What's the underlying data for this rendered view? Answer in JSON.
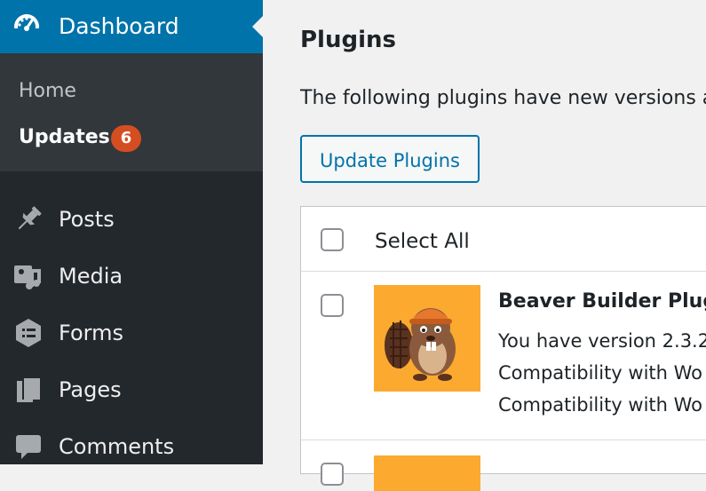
{
  "sidebar": {
    "dashboard": {
      "label": "Dashboard",
      "icon": "dashboard-gauge-icon"
    },
    "submenu": {
      "home": "Home",
      "updates": "Updates",
      "updates_count": "6"
    },
    "items": [
      {
        "label": "Posts",
        "icon": "pushpin-icon"
      },
      {
        "label": "Media",
        "icon": "media-icon"
      },
      {
        "label": "Forms",
        "icon": "forms-icon"
      },
      {
        "label": "Pages",
        "icon": "pages-icon"
      },
      {
        "label": "Comments",
        "icon": "comment-bubble-icon"
      }
    ]
  },
  "main": {
    "title": "Plugins",
    "intro": "The following plugins have new versions av",
    "update_button": "Update Plugins",
    "table": {
      "select_all": "Select All",
      "rows": [
        {
          "name": "Beaver Builder Plugin",
          "lines": [
            "You have version 2.3.2",
            "Compatibility with Wo",
            "Compatibility with Wo"
          ]
        }
      ]
    }
  },
  "colors": {
    "sidebar_bg": "#23282d",
    "submenu_bg": "#32373c",
    "accent": "#0073aa",
    "badge": "#d54e21",
    "plugin_thumb": "#fbaa2f"
  }
}
